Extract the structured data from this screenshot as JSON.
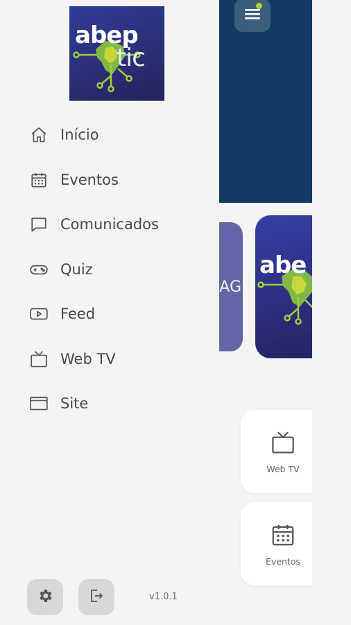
{
  "app": {
    "logo_text_top": "abep",
    "logo_text_bottom": "tic"
  },
  "menu": {
    "items": [
      {
        "label": "Início",
        "icon": "home-icon"
      },
      {
        "label": "Eventos",
        "icon": "calendar-icon"
      },
      {
        "label": "Comunicados",
        "icon": "chat-bubble-icon"
      },
      {
        "label": "Quiz",
        "icon": "gamepad-icon"
      },
      {
        "label": "Feed",
        "icon": "play-icon"
      },
      {
        "label": "Web TV",
        "icon": "tv-icon"
      },
      {
        "label": "Site",
        "icon": "browser-window-icon"
      }
    ]
  },
  "footer": {
    "settings_icon": "gear-icon",
    "logout_icon": "logout-icon",
    "version": "v1.0.1"
  },
  "main": {
    "partial_card_text": "AG",
    "card_logo_text": "abe",
    "tiles": [
      {
        "label": "Web TV",
        "icon": "tv-icon"
      },
      {
        "label": "Eventos",
        "icon": "calendar-icon"
      }
    ]
  },
  "colors": {
    "banner": "#133a63",
    "logo_bg": "#2b2f7a",
    "accent_green": "#b7d233",
    "drawer_bg": "#f4f4f4",
    "text": "#4a4a4a"
  }
}
